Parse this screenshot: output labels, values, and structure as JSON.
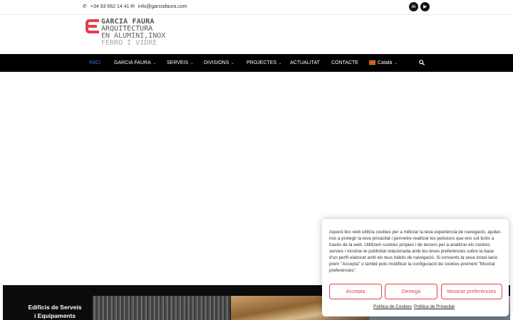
{
  "topbar": {
    "phone": "+34 93 662 14 41",
    "email": "info@garciafaura.com",
    "social": [
      {
        "name": "linkedin-icon",
        "glyph": "in"
      },
      {
        "name": "youtube-icon",
        "glyph": "▶"
      }
    ]
  },
  "logo": {
    "line1": "GARCIA FAURA",
    "line2": "ARQUITECTURA",
    "line3": "EN ALUMINI,INOX",
    "line4": "FERRO I VIDRE",
    "accent_color": "#e0404a"
  },
  "nav": {
    "items": [
      {
        "label": "INICI",
        "active": true,
        "dropdown": false
      },
      {
        "label": "GARCIA FAURA",
        "active": false,
        "dropdown": true
      },
      {
        "label": "SERVEIS",
        "active": false,
        "dropdown": true
      },
      {
        "label": "DIVISIONS",
        "active": false,
        "dropdown": true
      },
      {
        "label": "PROJECTES",
        "active": false,
        "dropdown": true
      },
      {
        "label": "ACTUALITAT",
        "active": false,
        "dropdown": false
      },
      {
        "label": "CONTACTE",
        "active": false,
        "dropdown": false
      }
    ],
    "language": "Català",
    "active_color": "#3c7bd8"
  },
  "gallery": {
    "caption_line1": "Edificis de Serveis",
    "caption_line2": "i Equipaments"
  },
  "cookie": {
    "message": "Aquest lloc web utilitza cookies per a millorar la teva experiència de navegació, ajudar-nos a protegir la teva privacitat i permetre realitzar les peticions que ens sol·licitis a través de la web. Utilitzem cookies pròpies i de tercers per a analitzar els nostres serveis i mostrar-te publicitat relacionada amb les teves preferències sobre la base d'un perfil elaborat amb els teus hàbits de navegació. Si consents la seva instal·lació prem \"Accepta\" o també pots modificar la configuració de cookies prement \"Mostrar preferències\".",
    "accept": "Accepta",
    "deny": "Denega",
    "preferences": "Mostrar preferències",
    "cookie_policy": "Política de Cookies",
    "privacy_policy": "Política de Privacitat",
    "button_color": "#e0404a"
  }
}
